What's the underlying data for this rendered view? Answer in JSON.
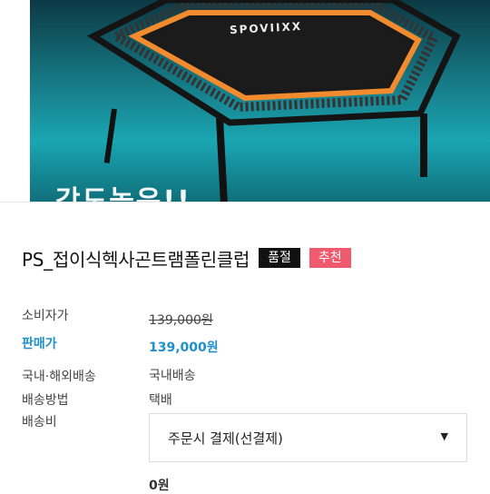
{
  "hero": {
    "caption": "강도높은!!",
    "brand": "SPOVIIXX"
  },
  "product": {
    "name": "PS_접이식헥사곤트램폴린클럽",
    "badges": {
      "soldout": "품절",
      "recommend": "추천"
    }
  },
  "info": {
    "consumer_price_label": "소비자가",
    "consumer_price": "139,000원",
    "sale_price_label": "판매가",
    "sale_price": "139,000원",
    "shipping_region_label": "국내·해외배송",
    "shipping_region": "국내배송",
    "shipping_method_label": "배송방법",
    "shipping_method": "택배",
    "shipping_fee_label": "배송비",
    "shipping_fee_option": "주문시 결제(선결제)",
    "shipping_fee_value": "0원"
  },
  "colors": {
    "accent_blue": "#1e8fcf",
    "badge_pink": "#f05a6e",
    "badge_black": "#111111",
    "frame_orange": "#f28a2e"
  }
}
